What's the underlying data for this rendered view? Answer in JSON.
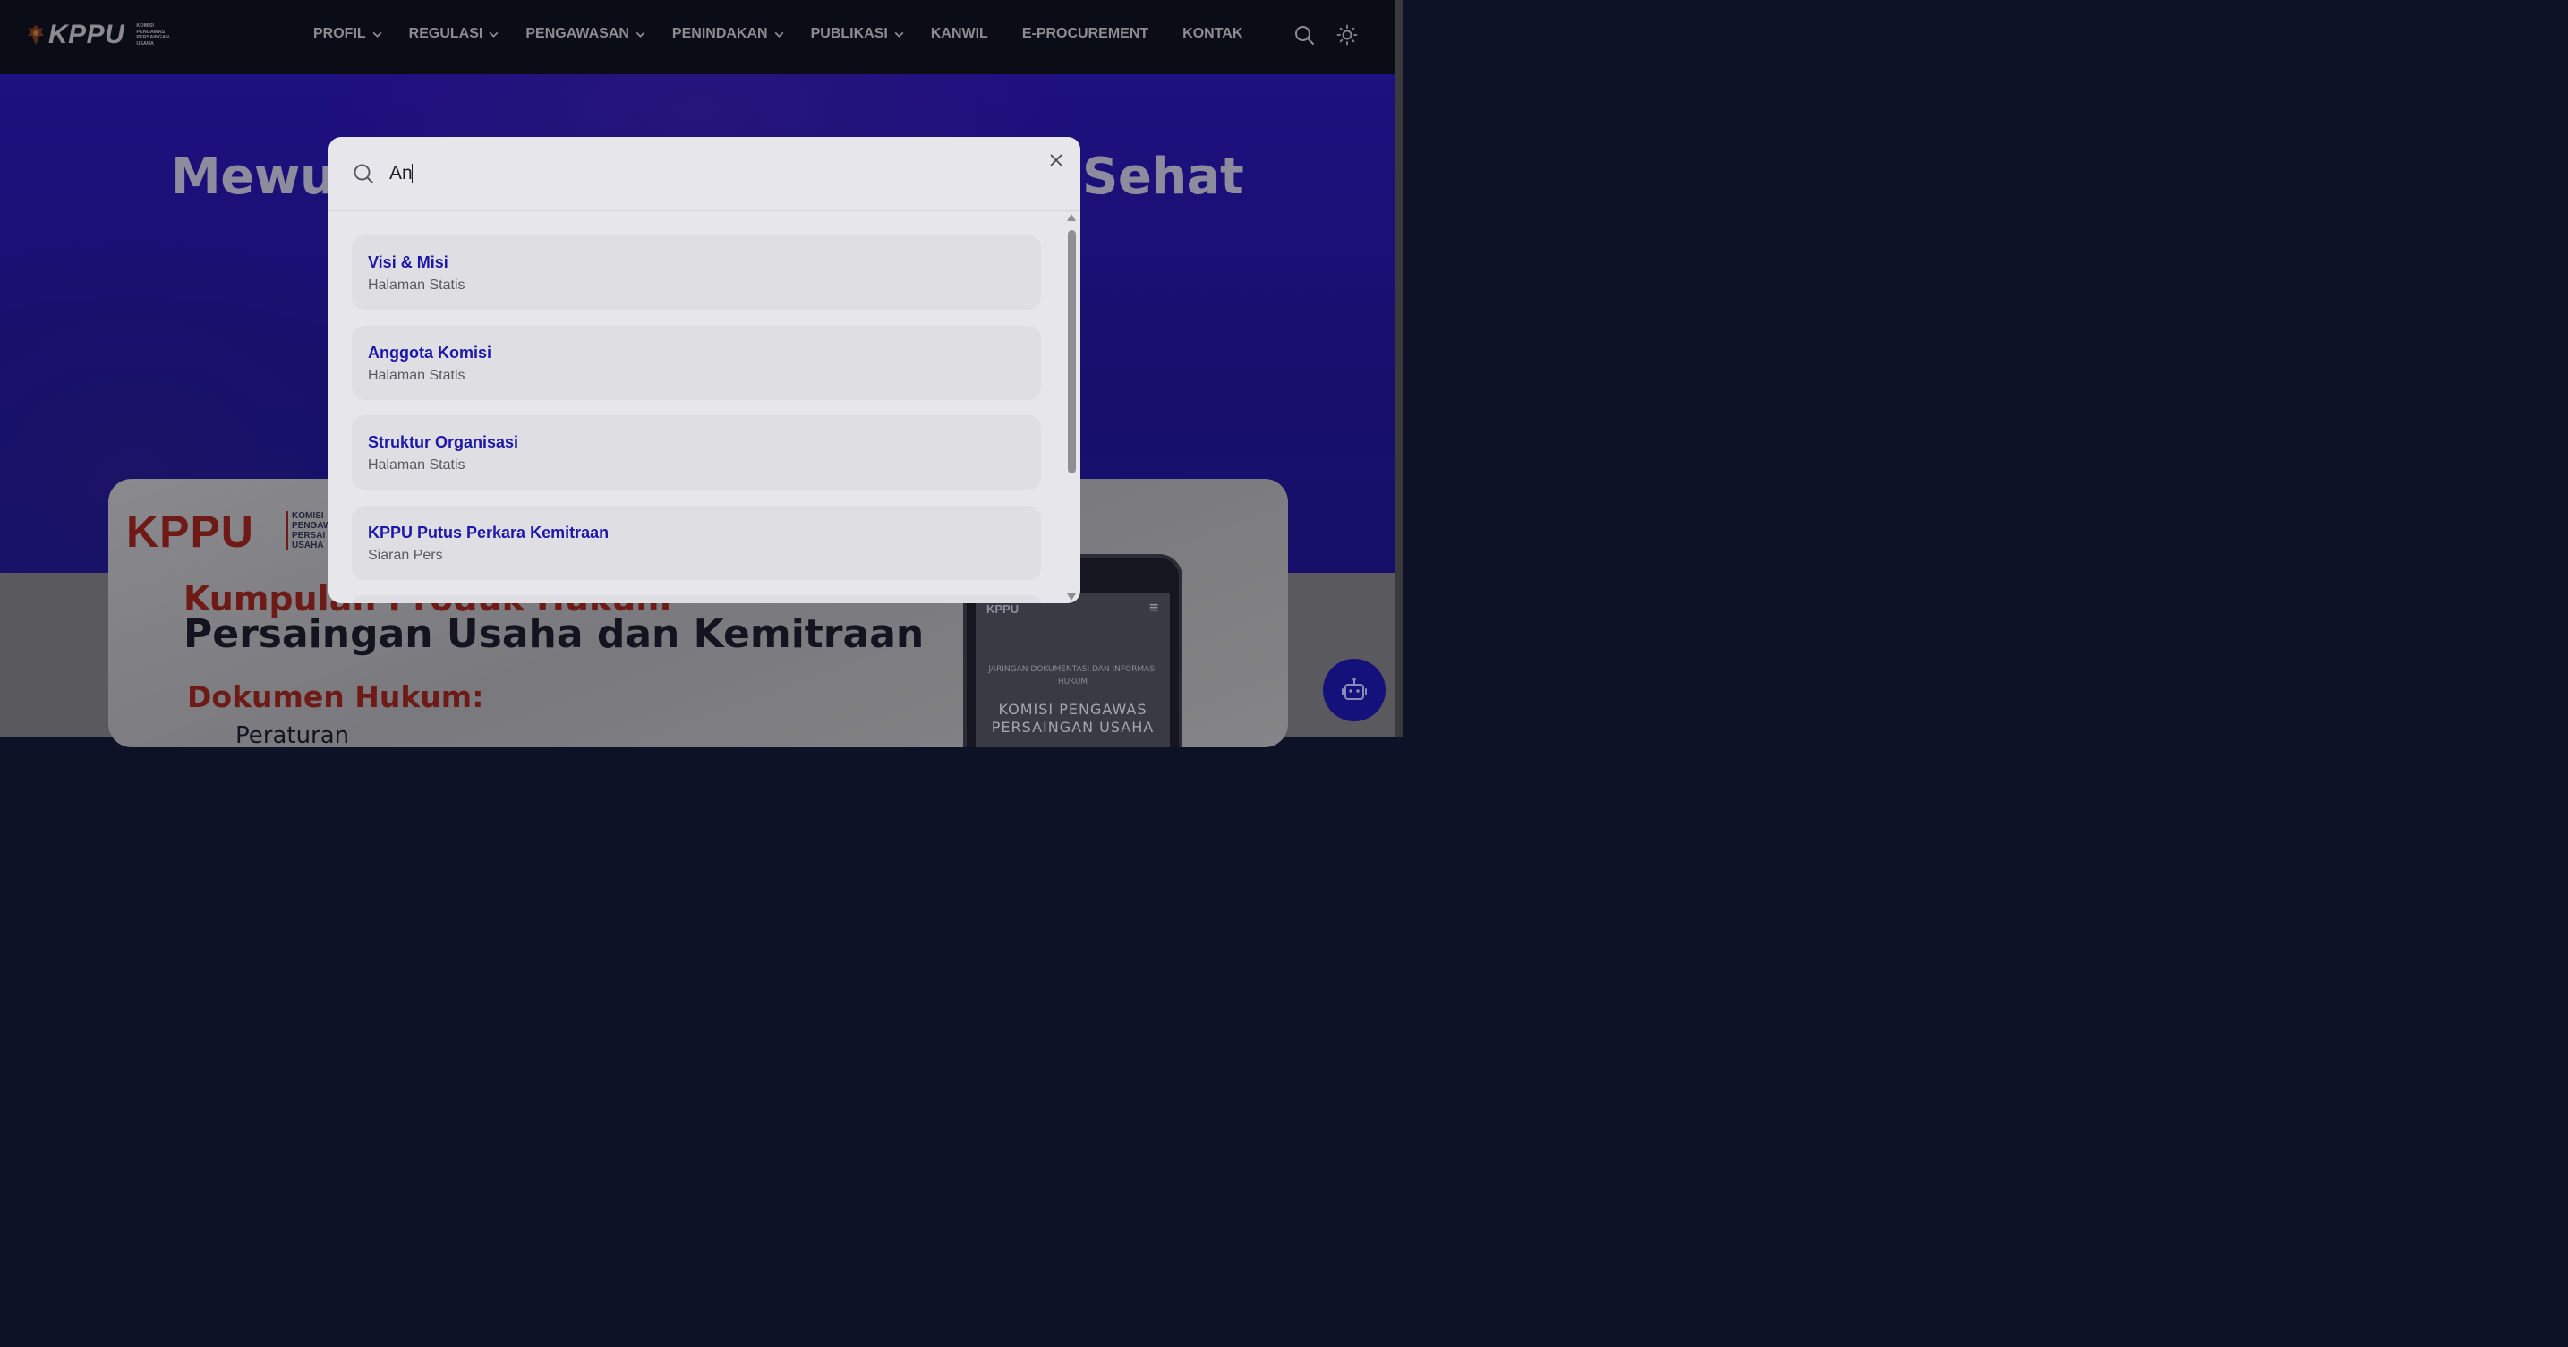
{
  "header": {
    "logo_text": "KPPU",
    "logo_sub": [
      "KOMISI",
      "PENGAWAS",
      "PERSAINGAN",
      "USAHA"
    ],
    "nav": [
      {
        "label": "PROFIL",
        "dropdown": true
      },
      {
        "label": "REGULASI",
        "dropdown": true
      },
      {
        "label": "PENGAWASAN",
        "dropdown": true
      },
      {
        "label": "PENINDAKAN",
        "dropdown": true
      },
      {
        "label": "PUBLIKASI",
        "dropdown": true
      },
      {
        "label": "KANWIL",
        "dropdown": false
      },
      {
        "label": "E-PROCUREMENT",
        "dropdown": false
      },
      {
        "label": "KONTAK",
        "dropdown": false
      }
    ],
    "icons": [
      "search-icon",
      "sun-icon"
    ]
  },
  "hero": {
    "title_left": "Mewuj",
    "title_right": "Sehat"
  },
  "banner": {
    "logo_text": "KPPU",
    "logo_sub": [
      "KOMISI",
      "PENGAW",
      "PERSAI",
      "USAHA"
    ],
    "line1": "Kumpulan Produk Hukum",
    "line2": "Persaingan Usaha dan Kemitraan",
    "line3": "Dokumen Hukum:",
    "line4": "Peraturan",
    "phone": {
      "logo": "KPPU",
      "small_text": "JARINGAN DOKUMENTASI DAN INFORMASI HUKUM",
      "big_text": "KOMISI PENGAWAS PERSAINGAN USAHA"
    }
  },
  "search": {
    "value": "An",
    "placeholder": "",
    "results": [
      {
        "title": "Visi & Misi",
        "category": "Halaman Statis"
      },
      {
        "title": "Anggota Komisi",
        "category": "Halaman Statis"
      },
      {
        "title": "Struktur Organisasi",
        "category": "Halaman Statis"
      },
      {
        "title": "KPPU Putus Perkara Kemitraan",
        "category": "Siaran Pers"
      }
    ]
  },
  "colors": {
    "header_bg": "#0b0d16",
    "hero_bg": "#1d1080",
    "modal_bg": "#e7e6ea",
    "result_title": "#1d18a8",
    "chat_fab": "#14117a"
  }
}
